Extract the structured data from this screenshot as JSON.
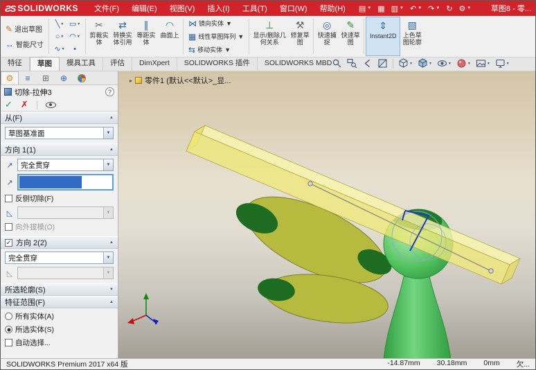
{
  "colors": {
    "titlebar_red": "#d2232a",
    "model_green": "#3cb54a",
    "wing_olive": "#b6ba3e",
    "wing_spot_green": "#1e6b22",
    "preview_yellow": "#efe878",
    "selection_blue": "#316ac5",
    "confirm_green": "#1e9e40",
    "cancel_red": "#d02020"
  },
  "glyphs": {
    "logo": "ƧS",
    "dropdown": "▼",
    "collapse": "▲",
    "check": "✓",
    "cancel": "✗",
    "direction": "↗",
    "draft": "◺",
    "pin_arrow": "▸"
  },
  "titlebar": {
    "brand": "SOLIDWORKS",
    "menus": [
      {
        "label": "文件(F)"
      },
      {
        "label": "编辑(E)"
      },
      {
        "label": "视图(V)"
      },
      {
        "label": "插入(I)"
      },
      {
        "label": "工具(T)"
      },
      {
        "label": "窗口(W)"
      },
      {
        "label": "帮助(H)"
      }
    ],
    "quick_access": [
      {
        "name": "new-document",
        "glyph": "▤"
      },
      {
        "name": "save",
        "glyph": "▦"
      },
      {
        "name": "print",
        "glyph": "▥"
      },
      {
        "name": "undo",
        "glyph": "↶"
      },
      {
        "name": "redo",
        "glyph": "↷"
      },
      {
        "name": "rebuild",
        "glyph": "↻"
      },
      {
        "name": "options",
        "glyph": "⚙"
      }
    ],
    "document_title": "草图8 - 零..."
  },
  "ribbon": {
    "exit_sketch": {
      "label": "退出草图",
      "glyph": "✎"
    },
    "smart_dimension": {
      "label": "智能尺寸",
      "glyph": "↔"
    },
    "sketch_tools": [
      {
        "name": "line-tool",
        "glyph": "╲"
      },
      {
        "name": "rectangle-tool",
        "glyph": "▭"
      },
      {
        "name": "circle-tool",
        "glyph": "○"
      },
      {
        "name": "arc-tool",
        "glyph": "◠"
      },
      {
        "name": "spline-tool",
        "glyph": "∿"
      },
      {
        "name": "point-tool",
        "glyph": "•"
      }
    ],
    "entity_buttons": [
      {
        "label": "剪裁实体",
        "glyph": "✂"
      },
      {
        "label": "转换实体引用",
        "glyph": "⇄"
      },
      {
        "label": "等距实体",
        "glyph": "∥"
      },
      {
        "label": "曲面上",
        "glyph": "◠"
      }
    ],
    "pattern_buttons": [
      {
        "label": "镜向实体",
        "glyph": "⋈"
      },
      {
        "label": "线性草图阵列",
        "glyph": "▦"
      },
      {
        "label": "移动实体",
        "glyph": "⇆"
      }
    ],
    "relations": {
      "label": "显示/删除几何关系",
      "glyph": "⊥"
    },
    "repair": {
      "label": "修复草图",
      "glyph": "⚒"
    },
    "quick_snaps": {
      "label": "快速捕捉",
      "glyph": "◎"
    },
    "rapid_sketch": {
      "label": "快速草图",
      "glyph": "✎"
    },
    "instant2d": {
      "label": "Instant2D",
      "glyph": "⇕"
    },
    "shaded_contours": {
      "label": "上色草图轮廓",
      "glyph": "▧"
    }
  },
  "tabs": [
    {
      "label": "特征"
    },
    {
      "label": "草图"
    },
    {
      "label": "模具工具"
    },
    {
      "label": "评估"
    },
    {
      "label": "DimXpert"
    },
    {
      "label": "SOLIDWORKS 插件"
    },
    {
      "label": "SOLIDWORKS MBD"
    }
  ],
  "pm_tabs": [
    {
      "name": "property-manager",
      "glyph": "⚙"
    },
    {
      "name": "feature-manager",
      "glyph": "≡"
    },
    {
      "name": "configurations",
      "glyph": "⊞"
    },
    {
      "name": "dimxpert-manager",
      "glyph": "⊕"
    },
    {
      "name": "display-manager",
      "glyph": ""
    }
  ],
  "property_manager": {
    "title": "切除-拉伸3",
    "help": "?",
    "from_section": {
      "header": "从(F)",
      "value": "草图基准面"
    },
    "direction1": {
      "header": "方向 1(1)",
      "end_condition": "完全贯穿",
      "flip_side": "反侧切除(F)",
      "draft_outward": "向外拔模(O)"
    },
    "direction2": {
      "header": "方向 2(2)",
      "end_condition": "完全贯穿"
    },
    "contours": {
      "header": "所选轮廓(S)"
    },
    "scope": {
      "header": "特征范围(F)",
      "all_bodies": "所有实体(A)",
      "selected_bodies": "所选实体(S)",
      "auto_select": "自动选择..."
    }
  },
  "viewport": {
    "breadcrumb": "零件1 (默认<<默认>_显..."
  },
  "statusbar": {
    "left": "SOLIDWORKS Premium 2017 x64 版",
    "x": "-14.87mm",
    "y": "30.18mm",
    "z": "0mm",
    "state": "欠..."
  }
}
